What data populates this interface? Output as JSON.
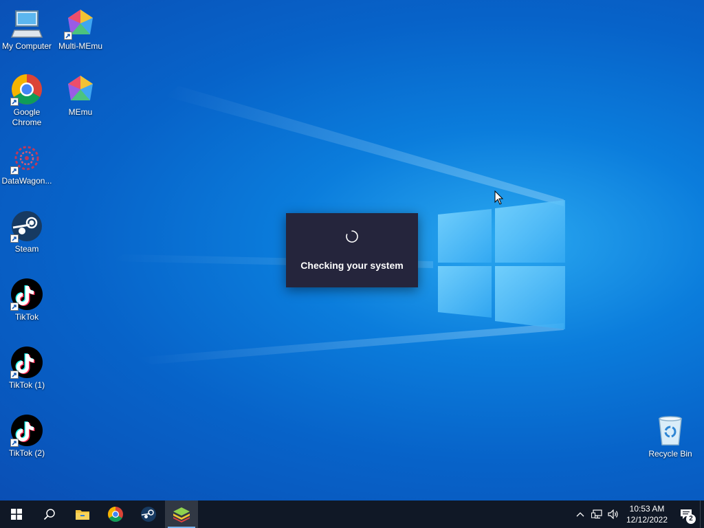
{
  "desktop": {
    "icons": [
      {
        "label": "My Computer",
        "icon": "computer-icon",
        "shortcut": false
      },
      {
        "label": "Multi-MEmu",
        "icon": "multi-memu-icon",
        "shortcut": true
      },
      {
        "label": "Google Chrome",
        "icon": "chrome-icon",
        "shortcut": true
      },
      {
        "label": "MEmu",
        "icon": "memu-icon",
        "shortcut": true
      },
      {
        "label": "DataWagon...",
        "icon": "datawagon-icon",
        "shortcut": true
      },
      {
        "label": "Steam",
        "icon": "steam-icon",
        "shortcut": true
      },
      {
        "label": "TikTok",
        "icon": "tiktok-icon",
        "shortcut": true
      },
      {
        "label": "TikTok (1)",
        "icon": "tiktok-icon",
        "shortcut": true
      },
      {
        "label": "TikTok (2)",
        "icon": "tiktok-icon",
        "shortcut": true
      },
      {
        "label": "Recycle Bin",
        "icon": "recycle-bin-icon",
        "shortcut": false
      }
    ]
  },
  "dialog": {
    "message": "Checking your system",
    "spinner_icon": "loading-spinner-icon"
  },
  "taskbar": {
    "buttons": [
      {
        "icon": "windows-start-icon"
      },
      {
        "icon": "search-icon"
      },
      {
        "icon": "file-explorer-icon"
      },
      {
        "icon": "chrome-icon"
      },
      {
        "icon": "steam-icon"
      },
      {
        "icon": "bluestacks-icon",
        "active": true
      }
    ],
    "tray": {
      "icons": [
        "chevron-up-icon",
        "network-icon",
        "volume-icon"
      ],
      "time": "10:53 AM",
      "date": "12/12/2022",
      "notification_count": "2"
    }
  },
  "colors": {
    "wallpaper_accent": "#0b7ddc",
    "taskbar_bg": "#101826",
    "dialog_bg": "#25253c"
  }
}
